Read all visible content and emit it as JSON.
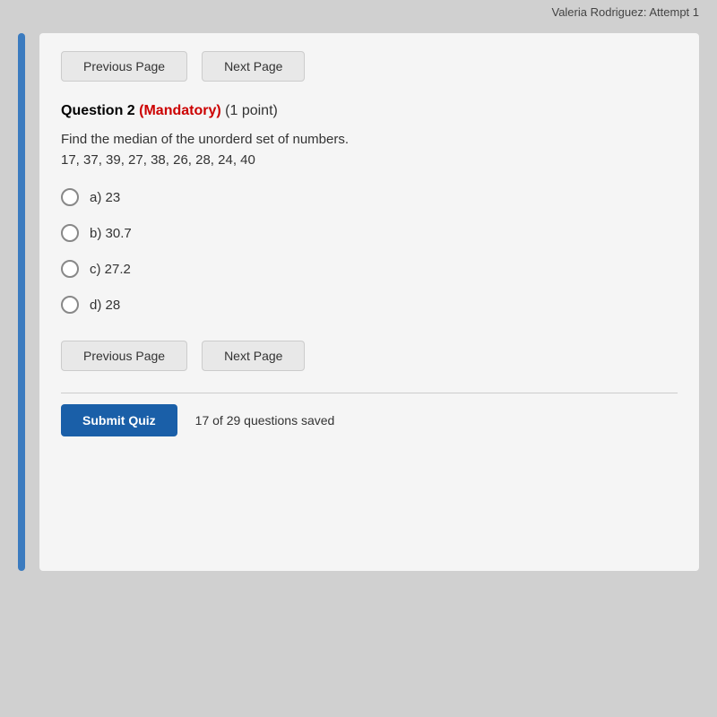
{
  "header": {
    "user_info": "Valeria Rodriguez: Attempt 1"
  },
  "nav_top": {
    "previous_label": "Previous Page",
    "next_label": "Next Page"
  },
  "question": {
    "number": "Question 2",
    "mandatory_label": "(Mandatory)",
    "points_label": "(1 point)",
    "text_line1": "Find the median of the unorderd set of numbers.",
    "text_line2": "17, 37, 39, 27, 38, 26, 28, 24, 40",
    "options": [
      {
        "label": "a) 23"
      },
      {
        "label": "b) 30.7"
      },
      {
        "label": "c) 27.2"
      },
      {
        "label": "d) 28"
      }
    ]
  },
  "nav_bottom": {
    "previous_label": "Previous Page",
    "next_label": "Next Page"
  },
  "footer": {
    "submit_label": "Submit Quiz",
    "saved_text": "17 of 29 questions saved"
  }
}
